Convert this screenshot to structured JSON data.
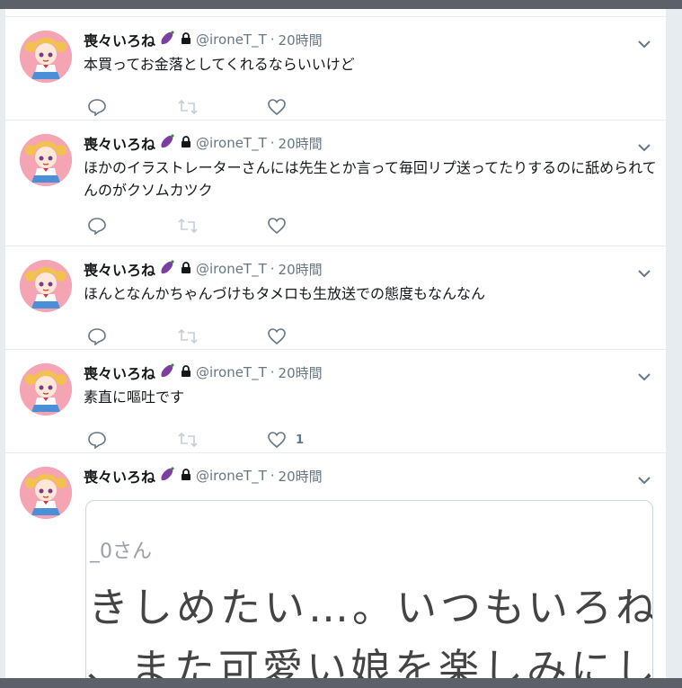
{
  "colors": {
    "background": "#e6ecf0",
    "frame": "#5c6068",
    "text": "#14171a",
    "secondary": "#657786",
    "avatar_bg": "#f5a4b4",
    "eggplant": "#7b3fa0"
  },
  "icons": {
    "eggplant": "eggplant-emoji",
    "lock": "lock-icon",
    "caret": "chevron-down-icon",
    "reply": "reply-icon",
    "retweet": "retweet-icon",
    "like": "heart-icon"
  },
  "tweets": [
    {
      "fullname": "喪々いろね",
      "username": "@ironeT_T",
      "separator": "·",
      "time": "20時間",
      "text": "本買ってお金落としてくれるならいいけど",
      "like_count": ""
    },
    {
      "fullname": "喪々いろね",
      "username": "@ironeT_T",
      "separator": "·",
      "time": "20時間",
      "text": "ほかのイラストレーターさんには先生とか言って毎回リプ送ってたりするのに舐められてんのがクソムカツク",
      "like_count": ""
    },
    {
      "fullname": "喪々いろね",
      "username": "@ironeT_T",
      "separator": "·",
      "time": "20時間",
      "text": "ほんとなんかちゃんづけもタメロも生放送での態度もなんなん",
      "like_count": ""
    },
    {
      "fullname": "喪々いろね",
      "username": "@ironeT_T",
      "separator": "·",
      "time": "20時間",
      "text": "素直に嘔吐です",
      "like_count": "1"
    },
    {
      "fullname": "喪々いろね",
      "username": "@ironeT_T",
      "separator": "·",
      "time": "20時間",
      "media": {
        "name_text": "_0さん",
        "line1": "きしめたい…。いつもいろね",
        "line2": "、また可愛い娘を楽しみにし"
      }
    }
  ]
}
